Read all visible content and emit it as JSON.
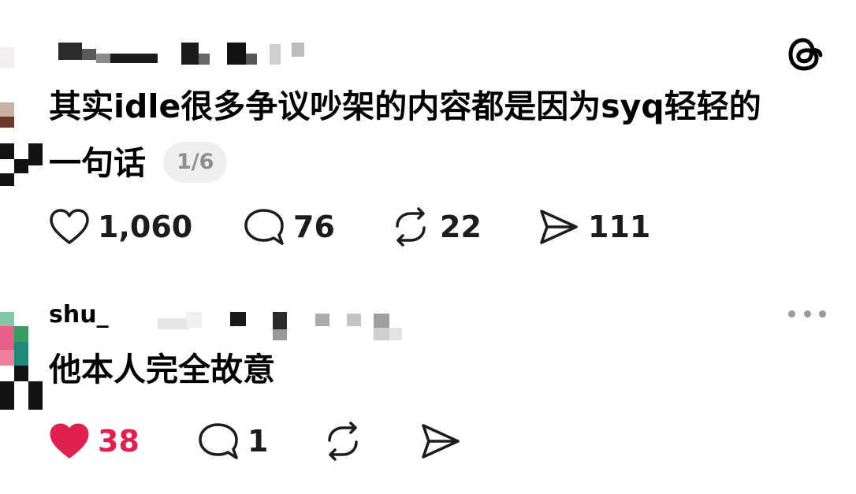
{
  "app": {
    "logo_icon": "threads-logo-icon"
  },
  "post": {
    "text_line1": "其实idle很多争议吵架的内容都是因为syq轻轻的",
    "text_line2": "一句话",
    "page_indicator": "1/6",
    "actions": {
      "like_count": "1,060",
      "reply_count": "76",
      "repost_count": "22",
      "share_count": "111"
    },
    "liked": false
  },
  "reply": {
    "username_visible": "shu_",
    "text": "他本人完全故意",
    "actions": {
      "like_count": "38",
      "reply_count": "1",
      "repost_count": "",
      "share_count": ""
    },
    "liked": true,
    "more_icon": "more-dots-icon"
  },
  "colors": {
    "liked_red": "#e0214f",
    "icon_dark": "#1c1c1c",
    "badge_bg": "#efefef",
    "badge_text": "#8e8e8e"
  }
}
